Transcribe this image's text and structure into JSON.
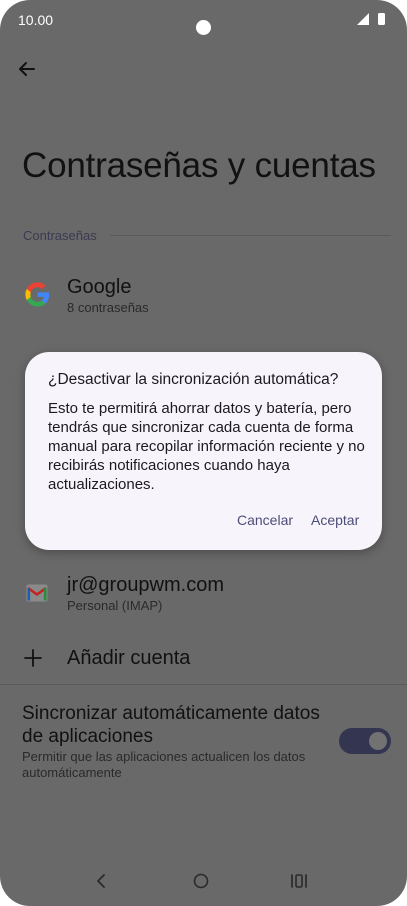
{
  "status_bar": {
    "time": "10.00",
    "icons": [
      "camera-cutout",
      "signal-icon",
      "battery-icon"
    ]
  },
  "header": {
    "back_icon": "arrow-left-icon",
    "title": "Contraseñas y cuentas"
  },
  "passwords_section": {
    "label": "Contraseñas",
    "items": [
      {
        "icon": "google-icon",
        "title": "Google",
        "subtitle": "8 contraseñas"
      }
    ]
  },
  "accounts": {
    "items": [
      {
        "icon": "gmail-icon",
        "title": "jr@groupwm.com",
        "subtitle": "Personal (IMAP)"
      }
    ],
    "add_account": {
      "icon": "plus-icon",
      "label": "Añadir cuenta"
    }
  },
  "auto_sync": {
    "title": "Sincronizar automáticamente datos de aplicaciones",
    "description": "Permitir que las aplicaciones actualicen los datos automáticamente",
    "enabled": true
  },
  "dialog": {
    "title": "¿Desactivar la sincronización automática?",
    "body": "Esto te permitirá ahorrar datos y batería, pero tendrás que sincronizar cada cuenta de forma manual para recopilar información reciente y no recibirás notificaciones cuando haya actualizaciones.",
    "cancel_label": "Cancelar",
    "accept_label": "Aceptar"
  },
  "nav_bar": {
    "icons": [
      "back-icon",
      "home-icon",
      "recents-icon"
    ]
  },
  "colors": {
    "scrim": "#696969",
    "dialog_bg": "#f8f4fb",
    "accent": "#4b4d78",
    "toggle_track": "#333551"
  }
}
